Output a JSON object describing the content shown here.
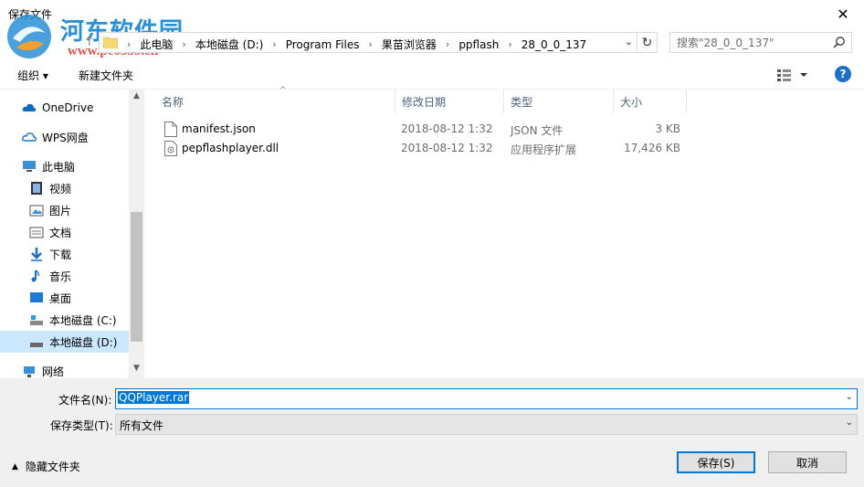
{
  "window": {
    "title": "保存文件",
    "close_glyph": "✕"
  },
  "watermark": {
    "title": "河东软件园",
    "url": "www.pc0359.cn"
  },
  "address": {
    "crumbs": [
      "此电脑",
      "本地磁盘 (D:)",
      "Program Files",
      "果苗浏览器",
      "ppflash",
      "28_0_0_137"
    ],
    "search_placeholder": "搜索\"28_0_0_137\""
  },
  "toolbar": {
    "organize": "组织 ▾",
    "new_folder": "新建文件夹",
    "help": "?"
  },
  "nav": {
    "items": [
      {
        "label": "OneDrive",
        "icon": "cloud-icon"
      },
      {
        "label": "WPS网盘",
        "icon": "wps-cloud-icon"
      },
      {
        "label": "此电脑",
        "icon": "computer-icon"
      },
      {
        "label": "视频",
        "icon": "video-icon"
      },
      {
        "label": "图片",
        "icon": "pictures-icon"
      },
      {
        "label": "文档",
        "icon": "documents-icon"
      },
      {
        "label": "下载",
        "icon": "download-icon"
      },
      {
        "label": "音乐",
        "icon": "music-icon"
      },
      {
        "label": "桌面",
        "icon": "desktop-icon"
      },
      {
        "label": "本地磁盘 (C:)",
        "icon": "drive-c-icon"
      },
      {
        "label": "本地磁盘 (D:)",
        "icon": "drive-d-icon",
        "selected": true
      },
      {
        "label": "网络",
        "icon": "network-icon"
      }
    ]
  },
  "files": {
    "headers": {
      "name": "名称",
      "date": "修改日期",
      "type": "类型",
      "size": "大小"
    },
    "rows": [
      {
        "name": "manifest.json",
        "date": "2018-08-12 1:32",
        "type": "JSON 文件",
        "size": "3 KB"
      },
      {
        "name": "pepflashplayer.dll",
        "date": "2018-08-12 1:32",
        "type": "应用程序扩展",
        "size": "17,426 KB"
      }
    ]
  },
  "save": {
    "filename_label": "文件名(N):",
    "filename_value": "QQPlayer.rar",
    "type_label": "保存类型(T):",
    "type_value": "所有文件",
    "hide_folders": "隐藏文件夹",
    "save_button": "保存(S)",
    "cancel_button": "取消"
  },
  "colors": {
    "accent": "#0078d7",
    "selected_bg": "#cce8ff",
    "header_text": "#4c607a"
  }
}
